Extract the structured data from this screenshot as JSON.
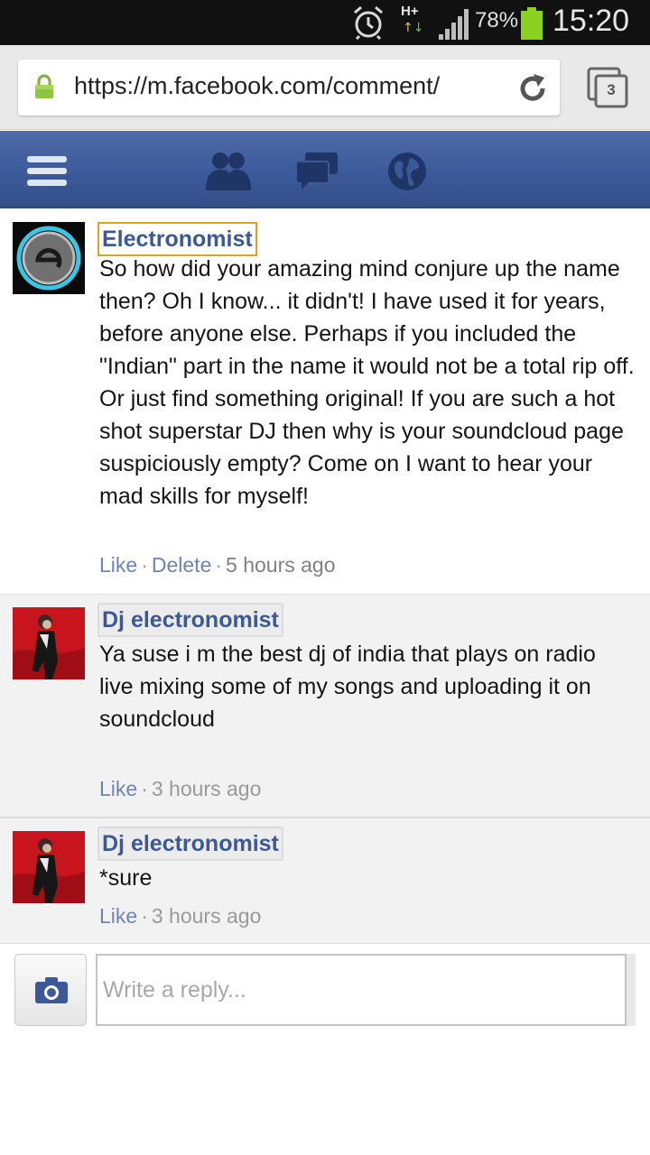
{
  "status_bar": {
    "network_label": "H+",
    "network_arrows_up": "↑",
    "network_arrows_down": "↓",
    "battery_percent": "78%",
    "battery_level": 0.78,
    "time": "15:20",
    "icons": [
      "alarm-icon",
      "network-icon",
      "signal-icon",
      "battery-icon"
    ]
  },
  "browser": {
    "url": "https://m.facebook.com/comment/",
    "tab_count": "3",
    "icons": [
      "lock-icon",
      "reload-icon",
      "tabs-icon"
    ]
  },
  "fb_header": {
    "icons": [
      "menu-icon",
      "friends-icon",
      "messages-icon",
      "globe-icon"
    ],
    "brand_color": "#3b5998"
  },
  "comments": [
    {
      "author": "Electronomist",
      "text": "So how did your amazing mind conjure up the name then? Oh I know... it didn't! I have used it for years, before anyone else. Perhaps if you included the \"Indian\" part in the name it would not be a total rip off. Or just find something original! If you are such a hot shot superstar DJ then why is your soundcloud page suspiciously empty? Come on I want to hear your mad skills for myself!",
      "like_label": "Like",
      "delete_label": "Delete",
      "time": "5 hours ago"
    },
    {
      "author": "Dj electronomist",
      "text_lines": [
        "Ya suse i m the best dj of india that plays on radio",
        "live mixing some of my songs and uploading it on soundcloud"
      ],
      "like_label": "Like",
      "time": "3 hours ago"
    },
    {
      "author": "Dj electronomist",
      "text": "*sure",
      "like_label": "Like",
      "time": "3 hours ago"
    }
  ],
  "separator": "·",
  "reply": {
    "placeholder": "Write a reply...",
    "icons": [
      "camera-icon"
    ]
  }
}
